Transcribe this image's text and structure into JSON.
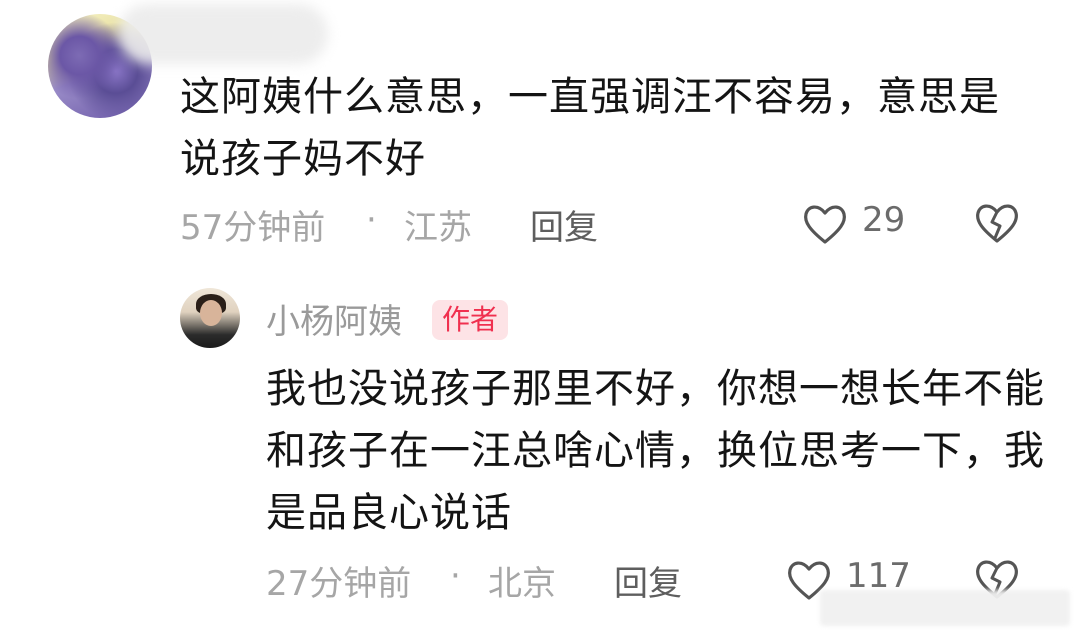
{
  "comment": {
    "text": "这阿姨什么意思，一直强调汪不容易，意思是说孩子妈不好",
    "time": "57分钟前",
    "separator": "·",
    "location": "江苏",
    "reply_label": "回复",
    "likes": "29",
    "like_icon": "heart-outline-icon",
    "dislike_icon": "broken-heart-icon"
  },
  "reply": {
    "author": "小杨阿姨",
    "badge": "作者",
    "badge_color": "#f0304f",
    "text": "我也没说孩子那里不好，你想一想长年不能和孩子在一汪总啥心情，换位思考一下，我是品良心说话",
    "time": "27分钟前",
    "separator": "·",
    "location": "北京",
    "reply_label": "回复",
    "likes": "117",
    "like_icon": "heart-outline-icon",
    "dislike_icon": "broken-heart-icon"
  }
}
